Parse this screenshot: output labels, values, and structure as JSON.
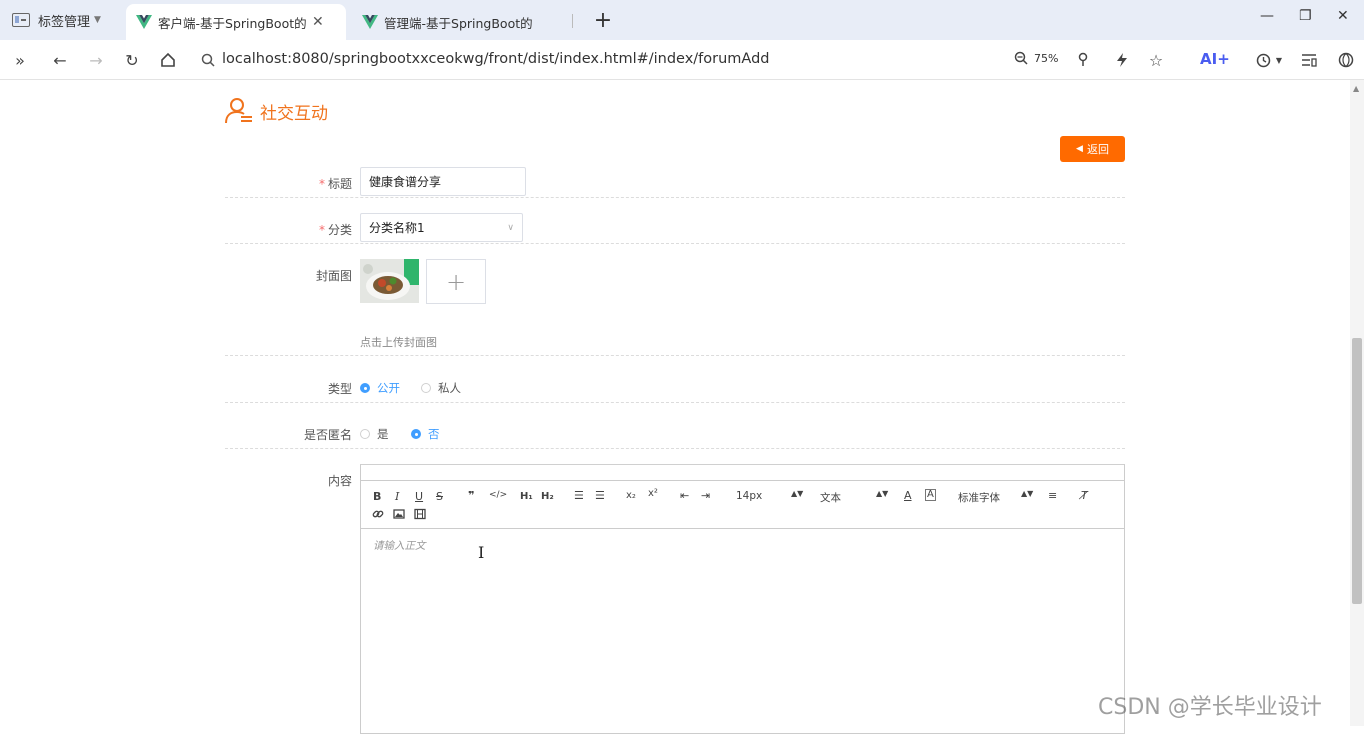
{
  "browser": {
    "tab_group_label": "标签管理",
    "tabs": [
      {
        "label": "客户端-基于SpringBoot的健康",
        "active": true
      },
      {
        "label": "管理端-基于SpringBoot的健康管",
        "active": false
      }
    ],
    "url": "localhost:8080/springbootxxceokwg/front/dist/index.html#/index/forumAdd",
    "zoom": "75%",
    "ai_label": "AI+"
  },
  "page": {
    "title": "社交互动",
    "back_label": "返回",
    "form": {
      "title_label": "标题",
      "title_value": "健康食谱分享",
      "category_label": "分类",
      "category_value": "分类名称1",
      "cover_label": "封面图",
      "cover_hint": "点击上传封面图",
      "type_label": "类型",
      "type_options": [
        "公开",
        "私人"
      ],
      "type_selected": "公开",
      "anon_label": "是否匿名",
      "anon_options": [
        "是",
        "否"
      ],
      "anon_selected": "否",
      "content_label": "内容",
      "content_placeholder": "请输入正文"
    },
    "editor_toolbar": {
      "font_size": "14px",
      "header": "文本",
      "font_family": "标准字体"
    }
  },
  "watermark": "CSDN @学长毕业设计",
  "colors": {
    "accent": "#ff6a00",
    "title": "#f0731d",
    "radio": "#409eff"
  }
}
